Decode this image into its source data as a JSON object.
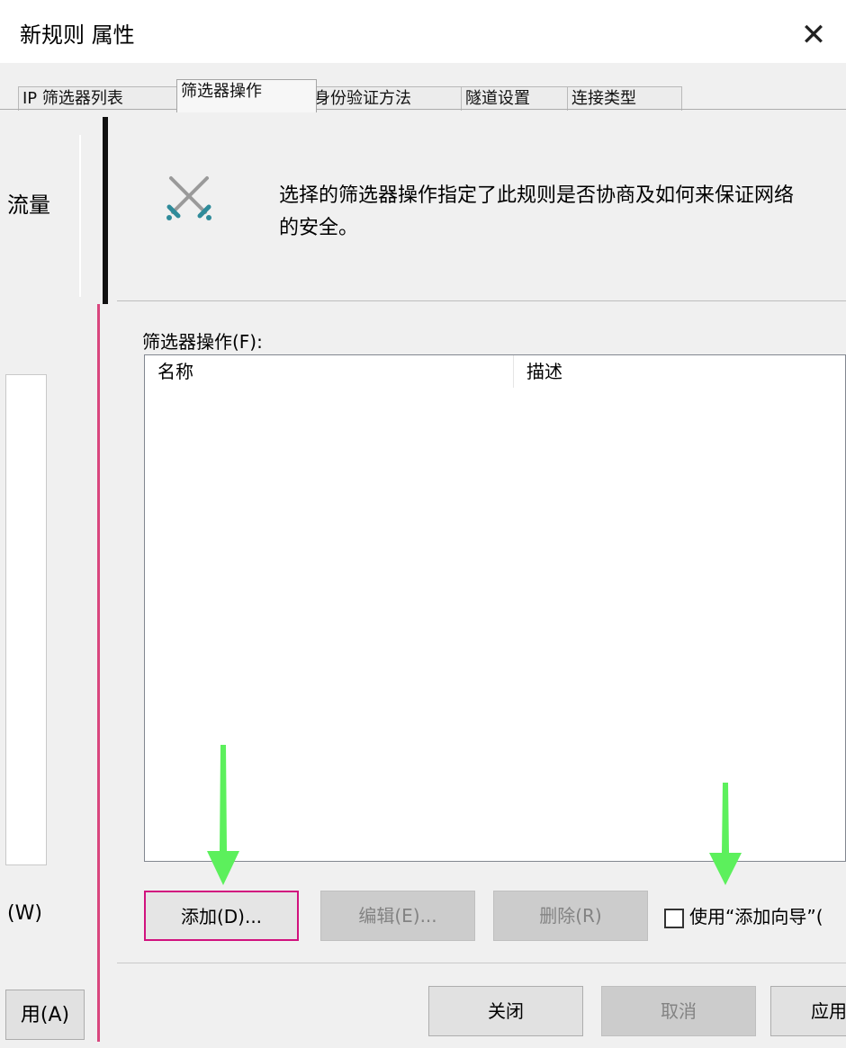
{
  "window": {
    "title": "新规则 属性",
    "close_glyph": "✕"
  },
  "tabs": [
    {
      "label": "IP 筛选器列表",
      "active": false
    },
    {
      "label": "筛选器操作",
      "active": true
    },
    {
      "label": "身份验证方法",
      "active": false
    },
    {
      "label": "隧道设置",
      "active": false
    },
    {
      "label": "连接类型",
      "active": false
    }
  ],
  "left_fragment": {
    "traffic_text": "流量",
    "w_text": "(W)",
    "a_button": "用(A)"
  },
  "info": {
    "icon": "crossed-swords-icon",
    "line1": "选择的筛选器操作指定了此规则是否协商及如何来保证网络",
    "line2": "的安全。"
  },
  "filter_actions": {
    "label": "筛选器操作(F):",
    "columns": [
      "名称",
      "描述"
    ],
    "rows": []
  },
  "buttons": {
    "add": "添加(D)...",
    "edit": "编辑(E)...",
    "delete": "删除(R)",
    "wizard_label": "使用“添加向导”(",
    "wizard_checked": false,
    "close": "关闭",
    "cancel": "取消",
    "apply": "应用"
  },
  "colors": {
    "highlight_border": "#d1127e",
    "arrow": "#5cf05c",
    "pink_divider": "#d9467e"
  }
}
